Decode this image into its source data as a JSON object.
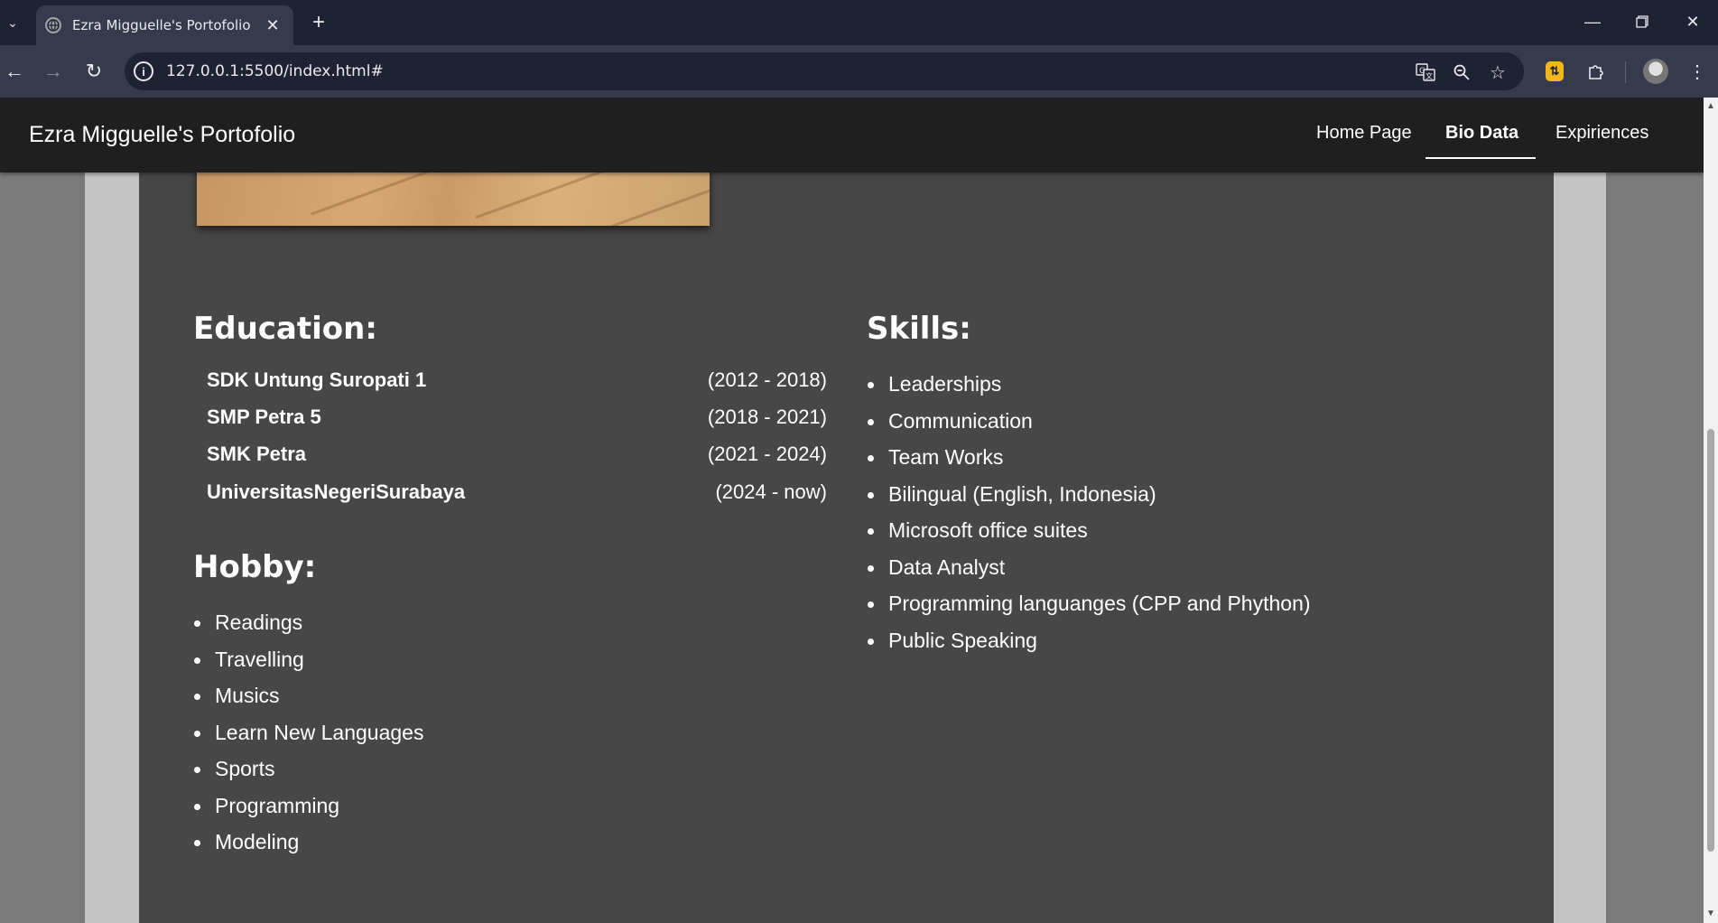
{
  "browser": {
    "tab_title": "Ezra Migguelle's Portofolio",
    "url": "127.0.0.1:5500/index.html#",
    "icons": {
      "tab_list": "chevron-down-icon",
      "favicon": "globe-icon",
      "tab_close": "close-icon",
      "new_tab": "plus-icon",
      "minimize": "minimize-icon",
      "restore": "restore-icon",
      "close_window": "close-icon",
      "back": "arrow-left-icon",
      "forward": "arrow-right-icon",
      "reload": "reload-icon",
      "site_info": "info-icon",
      "translate": "translate-icon",
      "zoom": "zoom-icon",
      "bookmark": "star-icon",
      "extension": "extension-icon",
      "extensions_menu": "puzzle-icon",
      "profile": "avatar",
      "menu": "kebab-menu-icon"
    }
  },
  "header": {
    "brand": "Ezra Migguelle's Portofolio",
    "nav": [
      {
        "label": "Home Page",
        "active": false
      },
      {
        "label": "Bio Data",
        "active": true
      },
      {
        "label": "Expiriences",
        "active": false
      }
    ]
  },
  "education": {
    "title": "Education:",
    "rows": [
      {
        "name": "SDK Untung Suropati 1",
        "years": "(2012 - 2018)"
      },
      {
        "name": "SMP Petra 5",
        "years": "(2018 - 2021)"
      },
      {
        "name": "SMK Petra",
        "years": "(2021 - 2024)"
      },
      {
        "name": "UniversitasNegeriSurabaya",
        "years": "(2024 - now)"
      }
    ]
  },
  "hobby": {
    "title": "Hobby:",
    "items": [
      "Readings",
      "Travelling",
      "Musics",
      "Learn New Languages",
      "Sports",
      "Programming",
      "Modeling"
    ]
  },
  "skills": {
    "title": "Skills:",
    "items": [
      "Leaderships",
      "Communication",
      "Team Works",
      "Bilingual (English, Indonesia)",
      "Microsoft office suites",
      "Data Analyst",
      "Programming languanges (CPP and Phython)",
      "Public Speaking"
    ]
  },
  "colors": {
    "header_bg": "#1f1f1f",
    "main_panel": "#474747",
    "side_panel": "#c4c4c4",
    "page_bg": "#7a7a7a",
    "text": "#ffffff"
  }
}
